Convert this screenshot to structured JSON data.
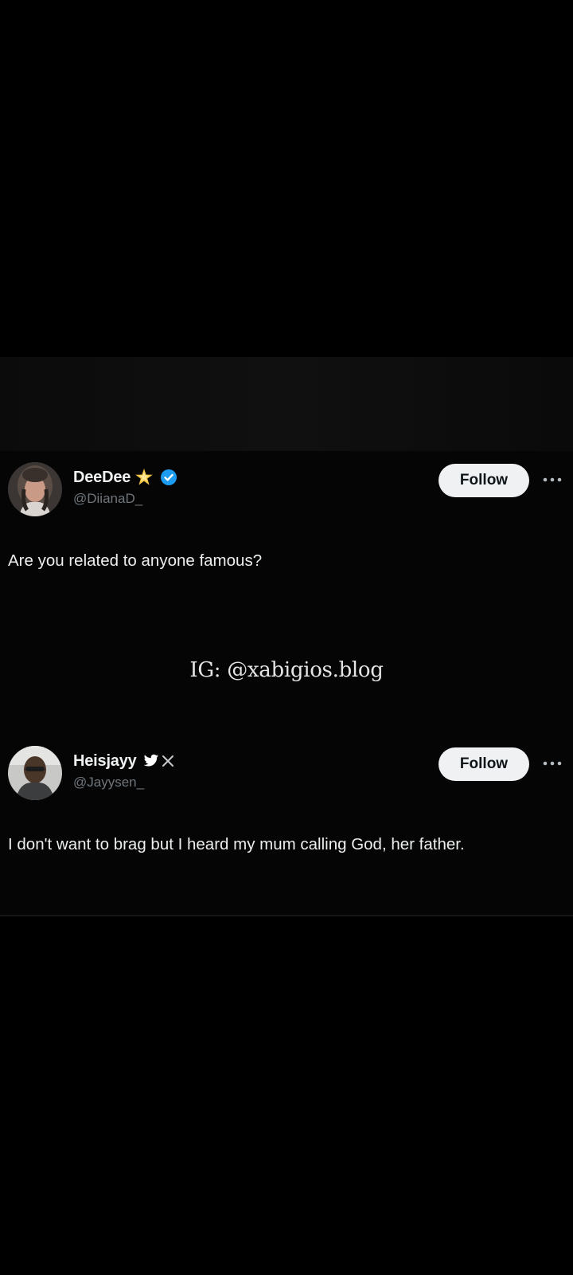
{
  "posts": [
    {
      "display_name": "DeeDee",
      "handle": "@DiianaD_",
      "follow_label": "Follow",
      "text": "Are you related to anyone famous?",
      "badges": [
        "star-emoji-icon",
        "verified-badge-icon"
      ]
    },
    {
      "display_name": "Heisjayy",
      "handle": "@Jayysen_",
      "follow_label": "Follow",
      "text": "I don't want to brag but I heard my mum calling God, her father.",
      "badges": [
        "bird-icon",
        "x-logo-icon"
      ]
    }
  ],
  "watermark": "IG: @xabigios.blog",
  "colors": {
    "background": "#000000",
    "verified": "#1d9bf0",
    "follow_button_bg": "#eff1f3",
    "handle_text": "#6f767c"
  }
}
